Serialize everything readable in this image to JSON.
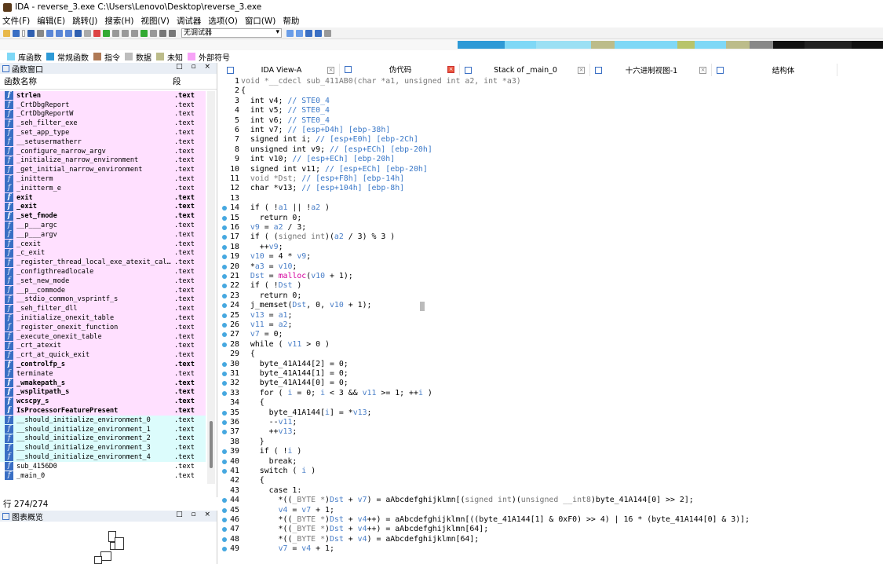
{
  "window": {
    "title": "IDA - reverse_3.exe C:\\Users\\Lenovo\\Desktop\\reverse_3.exe"
  },
  "menu": [
    "文件(F)",
    "编辑(E)",
    "跳转(J)",
    "搜索(H)",
    "视图(V)",
    "调试器",
    "选项(O)",
    "窗口(W)",
    "帮助"
  ],
  "toolbar": {
    "debugger_select": "无调试器"
  },
  "legend": [
    {
      "label": "库函数",
      "color": "#7fd8f6"
    },
    {
      "label": "常规函数",
      "color": "#2e9ad6"
    },
    {
      "label": "指令",
      "color": "#b07a56"
    },
    {
      "label": "数据",
      "color": "#bdbdbd"
    },
    {
      "label": "未知",
      "color": "#bcbc8a"
    },
    {
      "label": "外部符号",
      "color": "#f7a3f7"
    }
  ],
  "functions_panel": {
    "title": "函数窗口",
    "col_name": "函数名称",
    "col_segment": "段",
    "row_count": "行 274/274",
    "rows": [
      {
        "name": "strlen",
        "seg": ".text",
        "style": "pink",
        "bold": true
      },
      {
        "name": "_CrtDbgReport",
        "seg": ".text",
        "style": "pink",
        "bold": false
      },
      {
        "name": "_CrtDbgReportW",
        "seg": ".text",
        "style": "pink",
        "bold": false
      },
      {
        "name": "_seh_filter_exe",
        "seg": ".text",
        "style": "pink",
        "bold": false
      },
      {
        "name": "_set_app_type",
        "seg": ".text",
        "style": "pink",
        "bold": false
      },
      {
        "name": "__setusermatherr",
        "seg": ".text",
        "style": "pink",
        "bold": false
      },
      {
        "name": "_configure_narrow_argv",
        "seg": ".text",
        "style": "pink",
        "bold": false
      },
      {
        "name": "_initialize_narrow_environment",
        "seg": ".text",
        "style": "pink",
        "bold": false
      },
      {
        "name": "_get_initial_narrow_environment",
        "seg": ".text",
        "style": "pink",
        "bold": false
      },
      {
        "name": "_initterm",
        "seg": ".text",
        "style": "pink",
        "bold": false
      },
      {
        "name": "_initterm_e",
        "seg": ".text",
        "style": "pink",
        "bold": false
      },
      {
        "name": "exit",
        "seg": ".text",
        "style": "pink",
        "bold": true
      },
      {
        "name": "_exit",
        "seg": ".text",
        "style": "pink",
        "bold": true
      },
      {
        "name": "_set_fmode",
        "seg": ".text",
        "style": "pink",
        "bold": true
      },
      {
        "name": "__p___argc",
        "seg": ".text",
        "style": "pink",
        "bold": false
      },
      {
        "name": "__p___argv",
        "seg": ".text",
        "style": "pink",
        "bold": false
      },
      {
        "name": "_cexit",
        "seg": ".text",
        "style": "pink",
        "bold": false
      },
      {
        "name": "_c_exit",
        "seg": ".text",
        "style": "pink",
        "bold": false
      },
      {
        "name": "_register_thread_local_exe_atexit_call…",
        "seg": ".text",
        "style": "pink",
        "bold": false
      },
      {
        "name": "_configthreadlocale",
        "seg": ".text",
        "style": "pink",
        "bold": false
      },
      {
        "name": "_set_new_mode",
        "seg": ".text",
        "style": "pink",
        "bold": false
      },
      {
        "name": "__p__commode",
        "seg": ".text",
        "style": "pink",
        "bold": false
      },
      {
        "name": "__stdio_common_vsprintf_s",
        "seg": ".text",
        "style": "pink",
        "bold": false
      },
      {
        "name": "_seh_filter_dll",
        "seg": ".text",
        "style": "pink",
        "bold": false
      },
      {
        "name": "_initialize_onexit_table",
        "seg": ".text",
        "style": "pink",
        "bold": false
      },
      {
        "name": "_register_onexit_function",
        "seg": ".text",
        "style": "pink",
        "bold": false
      },
      {
        "name": "_execute_onexit_table",
        "seg": ".text",
        "style": "pink",
        "bold": false
      },
      {
        "name": "_crt_atexit",
        "seg": ".text",
        "style": "pink",
        "bold": false
      },
      {
        "name": "_crt_at_quick_exit",
        "seg": ".text",
        "style": "pink",
        "bold": false
      },
      {
        "name": "_controlfp_s",
        "seg": ".text",
        "style": "pink",
        "bold": true
      },
      {
        "name": "terminate",
        "seg": ".text",
        "style": "pink",
        "bold": false
      },
      {
        "name": "_wmakepath_s",
        "seg": ".text",
        "style": "pink",
        "bold": true
      },
      {
        "name": "_wsplitpath_s",
        "seg": ".text",
        "style": "pink",
        "bold": true
      },
      {
        "name": "wcscpy_s",
        "seg": ".text",
        "style": "pink",
        "bold": true
      },
      {
        "name": "IsProcessorFeaturePresent",
        "seg": ".text",
        "style": "pink",
        "bold": true
      },
      {
        "name": "__should_initialize_environment_0",
        "seg": ".text",
        "style": "cyan",
        "bold": false
      },
      {
        "name": "__should_initialize_environment_1",
        "seg": ".text",
        "style": "cyan",
        "bold": false
      },
      {
        "name": "__should_initialize_environment_2",
        "seg": ".text",
        "style": "cyan",
        "bold": false
      },
      {
        "name": "__should_initialize_environment_3",
        "seg": ".text",
        "style": "cyan",
        "bold": false
      },
      {
        "name": "__should_initialize_environment_4",
        "seg": ".text",
        "style": "cyan",
        "bold": false
      },
      {
        "name": "sub_4156D0",
        "seg": ".text",
        "style": "white",
        "bold": false
      },
      {
        "name": "_main_0",
        "seg": ".text",
        "style": "white",
        "bold": false
      }
    ]
  },
  "overview_panel": {
    "title": "图表概览"
  },
  "tabs": [
    {
      "label": "IDA View-A",
      "active": false
    },
    {
      "label": "伪代码",
      "active": true
    },
    {
      "label": "Stack of _main_0",
      "active": false
    },
    {
      "label": "十六进制视图-1",
      "active": false
    },
    {
      "label": "结构体",
      "active": false
    }
  ],
  "code_lines": [
    {
      "n": "1",
      "dot": false,
      "html": "void *__cdecl sub_411AB0(char *a1, unsigned int a2, int *a3)",
      "cls": "gr"
    },
    {
      "n": "2",
      "dot": false,
      "html": "{"
    },
    {
      "n": "3",
      "dot": false,
      "html": "  int v4; <span class='cm'>// STE0_4</span>"
    },
    {
      "n": "4",
      "dot": false,
      "html": "  int v5; <span class='cm'>// STE0_4</span>"
    },
    {
      "n": "5",
      "dot": false,
      "html": "  int v6; <span class='cm'>// STE0_4</span>"
    },
    {
      "n": "6",
      "dot": false,
      "html": "  int v7; <span class='cm'>// [esp+D4h] [ebp-38h]</span>"
    },
    {
      "n": "7",
      "dot": false,
      "html": "  signed int i; <span class='cm'>// [esp+E0h] [ebp-2Ch]</span>"
    },
    {
      "n": "8",
      "dot": false,
      "html": "  unsigned int v9; <span class='cm'>// [esp+ECh] [ebp-20h]</span>"
    },
    {
      "n": "9",
      "dot": false,
      "html": "  int v10; <span class='cm'>// [esp+ECh] [ebp-20h]</span>"
    },
    {
      "n": "10",
      "dot": false,
      "html": "  signed int v11; <span class='cm'>// [esp+ECh] [ebp-20h]</span>"
    },
    {
      "n": "11",
      "dot": false,
      "html": "  <span class='gr'>void *Dst;</span> <span class='cm'>// [esp+F8h] [ebp-14h]</span>"
    },
    {
      "n": "12",
      "dot": false,
      "html": "  char *v13; <span class='cm'>// [esp+104h] [ebp-8h]</span>"
    },
    {
      "n": "13",
      "dot": false,
      "html": ""
    },
    {
      "n": "14",
      "dot": true,
      "html": "  if ( !<span class='v'>a1</span> || !<span class='v'>a2</span> )"
    },
    {
      "n": "15",
      "dot": true,
      "html": "    return 0;"
    },
    {
      "n": "16",
      "dot": true,
      "html": "  <span class='v'>v9</span> = <span class='v'>a2</span> / 3;"
    },
    {
      "n": "17",
      "dot": true,
      "html": "  if ( (<span class='gr'>signed int</span>)(<span class='v'>a2</span> / 3) % 3 )"
    },
    {
      "n": "18",
      "dot": true,
      "html": "    ++<span class='v'>v9</span>;"
    },
    {
      "n": "19",
      "dot": true,
      "html": "  <span class='v'>v10</span> = 4 * <span class='v'>v9</span>;"
    },
    {
      "n": "20",
      "dot": true,
      "html": "  *<span class='v'>a3</span> = <span class='v'>v10</span>;"
    },
    {
      "n": "21",
      "dot": true,
      "html": "  <span class='v'>Dst</span> = <span class='fn'>malloc</span>(<span class='v'>v10</span> + 1);"
    },
    {
      "n": "22",
      "dot": true,
      "html": "  if ( !<span class='v'>Dst</span> )"
    },
    {
      "n": "23",
      "dot": true,
      "html": "    return 0;"
    },
    {
      "n": "24",
      "dot": true,
      "html": "  j_memset(<span class='v'>Dst</span>, 0, <span class='v'>v10</span> + 1);"
    },
    {
      "n": "25",
      "dot": true,
      "html": "  <span class='v'>v13</span> = <span class='v'>a1</span>;"
    },
    {
      "n": "26",
      "dot": true,
      "html": "  <span class='v'>v11</span> = <span class='v'>a2</span>;"
    },
    {
      "n": "27",
      "dot": true,
      "html": "  <span class='v'>v7</span> = 0;"
    },
    {
      "n": "28",
      "dot": true,
      "html": "  while ( <span class='v'>v11</span> > 0 )"
    },
    {
      "n": "29",
      "dot": false,
      "html": "  {"
    },
    {
      "n": "30",
      "dot": true,
      "html": "    byte_41A144[2] = 0;"
    },
    {
      "n": "31",
      "dot": true,
      "html": "    byte_41A144[1] = 0;"
    },
    {
      "n": "32",
      "dot": true,
      "html": "    byte_41A144[0] = 0;"
    },
    {
      "n": "33",
      "dot": true,
      "html": "    for ( <span class='v'>i</span> = 0; <span class='v'>i</span> < 3 && <span class='v'>v11</span> >= 1; ++<span class='v'>i</span> )"
    },
    {
      "n": "34",
      "dot": false,
      "html": "    {"
    },
    {
      "n": "35",
      "dot": true,
      "html": "      byte_41A144[<span class='v'>i</span>] = *<span class='v'>v13</span>;"
    },
    {
      "n": "36",
      "dot": true,
      "html": "      --<span class='v'>v11</span>;"
    },
    {
      "n": "37",
      "dot": true,
      "html": "      ++<span class='v'>v13</span>;"
    },
    {
      "n": "38",
      "dot": false,
      "html": "    }"
    },
    {
      "n": "39",
      "dot": true,
      "html": "    if ( !<span class='v'>i</span> )"
    },
    {
      "n": "40",
      "dot": true,
      "html": "      break;"
    },
    {
      "n": "41",
      "dot": true,
      "html": "    switch ( <span class='v'>i</span> )"
    },
    {
      "n": "42",
      "dot": false,
      "html": "    {"
    },
    {
      "n": "43",
      "dot": false,
      "html": "      case 1:"
    },
    {
      "n": "44",
      "dot": true,
      "html": "        *((<span class='gr'>_BYTE *</span>)<span class='v'>Dst</span> + <span class='v'>v7</span>) = aAbcdefghijklmn[(<span class='gr'>signed int</span>)(<span class='gr'>unsigned __int8</span>)byte_41A144[0] >> 2];"
    },
    {
      "n": "45",
      "dot": true,
      "html": "        <span class='v'>v4</span> = <span class='v'>v7</span> + 1;"
    },
    {
      "n": "46",
      "dot": true,
      "html": "        *((<span class='gr'>_BYTE *</span>)<span class='v'>Dst</span> + <span class='v'>v4</span>++) = aAbcdefghijklmn[((byte_41A144[1] & 0xF0) >> 4) | 16 * (byte_41A144[0] & 3)];"
    },
    {
      "n": "47",
      "dot": true,
      "html": "        *((<span class='gr'>_BYTE *</span>)<span class='v'>Dst</span> + <span class='v'>v4</span>++) = aAbcdefghijklmn[64];"
    },
    {
      "n": "48",
      "dot": true,
      "html": "        *((<span class='gr'>_BYTE *</span>)<span class='v'>Dst</span> + <span class='v'>v4</span>) = aAbcdefghijklmn[64];"
    },
    {
      "n": "49",
      "dot": true,
      "html": "        <span class='v'>v7</span> = <span class='v'>v4</span> + 1;"
    }
  ]
}
